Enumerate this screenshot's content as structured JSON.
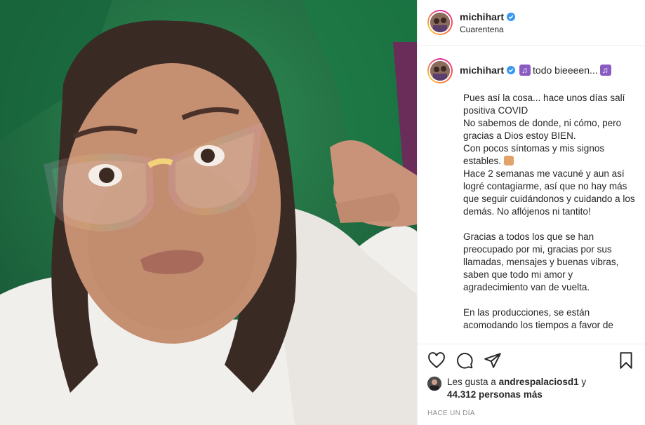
{
  "post": {
    "username": "michihart",
    "location": "Cuarentena",
    "caption_suffix": "todo bieeeen...",
    "caption_paragraphs": [
      [
        "Pues así la cosa... hace unos días salí positiva COVID",
        "No sabemos de donde, ni cómo, pero gracias a Dios estoy BIEN.",
        "Con pocos síntomas y mis signos estables.",
        "Hace 2 semanas me vacuné y aun así logré contagiarme, así que no hay más que seguir cuidándonos y cuidando a los demás. No aflójenos ni tantito!"
      ],
      [
        "Gracias a todos los que se han preocupado por mi, gracias por sus llamadas, mensajes y buenas vibras, saben que todo mi amor y agradecimiento van de vuelta."
      ],
      [
        "En las producciones, se están acomodando los tiempos a favor de"
      ]
    ],
    "likes_prefix": "Les gusta a",
    "liker": "andrespalaciosd1",
    "likes_conj": "y",
    "likes_count": "44.312 personas más",
    "timestamp": "HACE UN DÍA"
  },
  "icons": {
    "verified": "verified-badge-icon",
    "like": "heart-icon",
    "comment": "comment-icon",
    "share": "share-icon",
    "save": "bookmark-icon"
  },
  "colors": {
    "verified": "#3897f0",
    "text": "#262626",
    "muted": "#8e8e8e",
    "border": "#efefef"
  }
}
